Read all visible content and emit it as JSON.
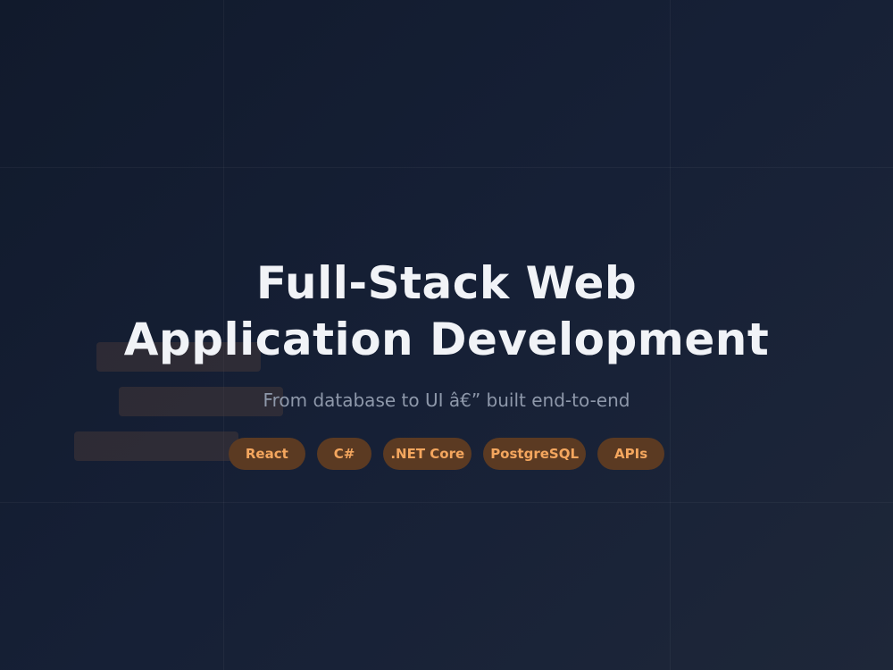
{
  "hero": {
    "title_line1": "Full-Stack Web",
    "title_line2": "Application Development",
    "subtitle": "From database to UI â€” built end-to-end"
  },
  "tags": [
    "React",
    "C#",
    ".NET Core",
    "PostgreSQL",
    "APIs"
  ],
  "colors": {
    "background": "#131b2e",
    "title": "#f1f3f7",
    "subtitle": "#8e98aa",
    "tag_bg": "#5b3a22",
    "tag_text": "#f4a65e"
  }
}
